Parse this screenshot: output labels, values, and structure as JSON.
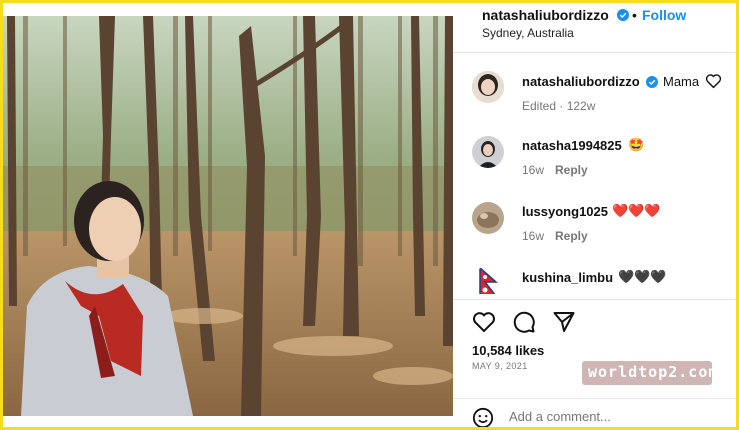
{
  "post": {
    "author": "natashaliubordizzo",
    "separator": "•",
    "follow_label": "Follow",
    "location": "Sydney, Australia"
  },
  "caption": {
    "username": "natashaliubordizzo",
    "text": "Mama",
    "meta": "Edited · 122w"
  },
  "comments": [
    {
      "username": "natasha1994825",
      "text": "🤩",
      "age": "16w",
      "reply_label": "Reply"
    },
    {
      "username": "lussyong1025",
      "text": "❤️❤️❤️",
      "age": "16w",
      "reply_label": "Reply"
    },
    {
      "username": "kushina_limbu",
      "text": "🖤🖤🖤"
    }
  ],
  "stats": {
    "likes": "10,584 likes",
    "date": "MAY 9, 2021"
  },
  "watermark": "worldtop2.com",
  "add_comment": {
    "placeholder": "Add a comment..."
  },
  "colors": {
    "accent": "#1a8ff0",
    "frame": "#f5dc1c",
    "heart_red": "#e0263c"
  },
  "icons": [
    "verified-badge-icon",
    "heart-icon",
    "comment-icon",
    "share-icon",
    "emoji-icon"
  ]
}
